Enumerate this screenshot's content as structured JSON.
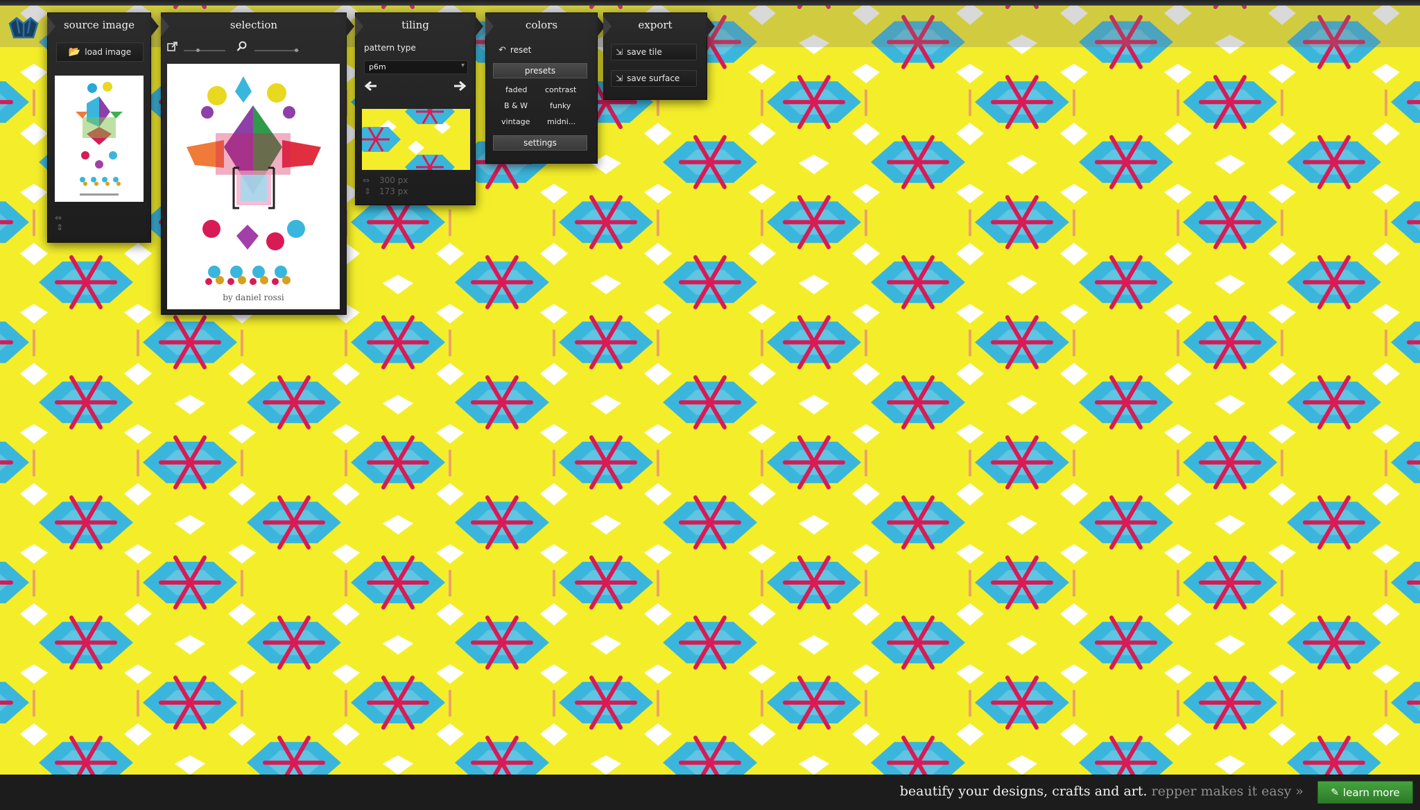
{
  "app": {
    "logo_icon": "repper-logo-icon"
  },
  "panels": {
    "source_image": {
      "title": "source image",
      "load_button_label": "load image",
      "folder_icon": "folder-icon"
    },
    "selection": {
      "title": "selection",
      "caption": "by daniel rossi",
      "external_icon": "external-link-icon",
      "zoom_icon": "magnifier-icon"
    },
    "tiling": {
      "title": "tiling",
      "pattern_type_label": "pattern type",
      "pattern_type_value": "p6m",
      "width_value": "300 px",
      "height_value": "173 px"
    },
    "colors": {
      "title": "colors",
      "reset_label": "reset",
      "presets_label": "presets",
      "presets": [
        "faded",
        "contrast",
        "B & W",
        "funky",
        "vintage",
        "midni..."
      ],
      "settings_label": "settings"
    },
    "export": {
      "title": "export",
      "save_tile_label": "save tile",
      "save_surface_label": "save surface"
    }
  },
  "banner": {
    "main_text": "beautify your designs, crafts and art.",
    "sub_text": "repper makes it easy »",
    "button_label": "learn more"
  },
  "colors": {
    "yellow": "#f4ee2a",
    "cyan": "#3ab6dc",
    "magenta": "#d81b55",
    "white": "#ffffff",
    "panel_bg": "#232323",
    "learn_green": "#3a9634"
  }
}
